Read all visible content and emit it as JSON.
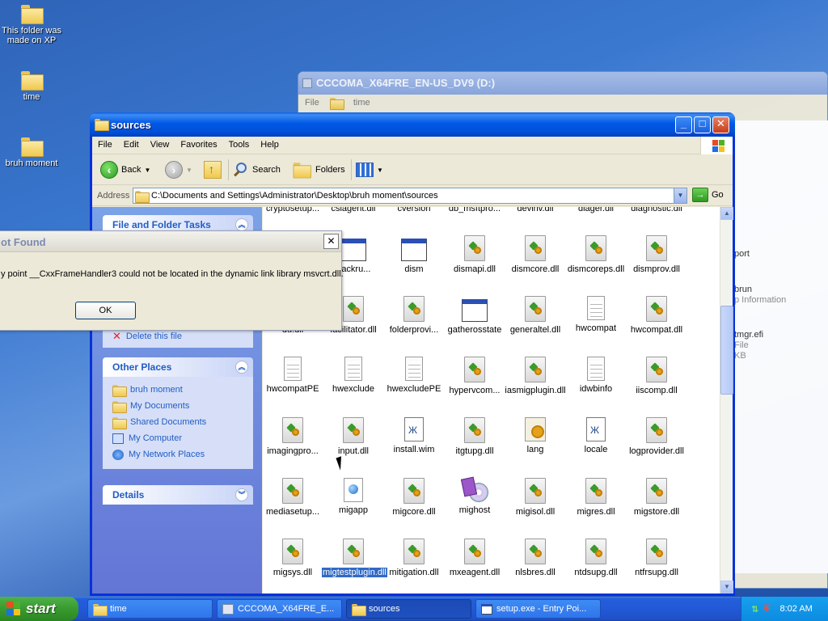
{
  "desktop": {
    "icons": [
      {
        "label": "This folder was made on XP"
      },
      {
        "label": "time"
      },
      {
        "label": "bruh moment"
      }
    ]
  },
  "back_window": {
    "title": "CCCOMA_X64FRE_EN-US_DV9 (D:)",
    "menu_file": "File",
    "tab": "time",
    "side_texts": [
      "port",
      "brun",
      "p Information",
      "tmgr.efi",
      "File",
      "KB"
    ]
  },
  "window": {
    "title": "sources",
    "menu": [
      "File",
      "Edit",
      "View",
      "Favorites",
      "Tools",
      "Help"
    ],
    "toolbar": {
      "back": "Back",
      "search": "Search",
      "folders": "Folders"
    },
    "address": {
      "label": "Address",
      "path": "C:\\Documents and Settings\\Administrator\\Desktop\\bruh moment\\sources",
      "go": "Go"
    },
    "tasks_panel": {
      "title": "File and Folder Tasks",
      "delete": "Delete this file"
    },
    "other_places": {
      "title": "Other Places",
      "items": [
        "bruh moment",
        "My Documents",
        "Shared Documents",
        "My Computer",
        "My Network Places"
      ]
    },
    "details": {
      "title": "Details"
    },
    "files": [
      {
        "name": "cryptosetup...",
        "icon": "dll"
      },
      {
        "name": "csiagent.dll",
        "icon": "dll"
      },
      {
        "name": "cversion",
        "icon": "dll"
      },
      {
        "name": "db_msftpro...",
        "icon": "dll"
      },
      {
        "name": "devinv.dll",
        "icon": "dll"
      },
      {
        "name": "diager.dll",
        "icon": "dll"
      },
      {
        "name": "diagnostic.dll",
        "icon": "dll"
      },
      {
        "name": "",
        "icon": "none"
      },
      {
        "name": "trackru...",
        "icon": "exe"
      },
      {
        "name": "dism",
        "icon": "exe"
      },
      {
        "name": "dismapi.dll",
        "icon": "dll"
      },
      {
        "name": "dismcore.dll",
        "icon": "dll"
      },
      {
        "name": "dismcoreps.dll",
        "icon": "dll"
      },
      {
        "name": "dismprov.dll",
        "icon": "dll"
      },
      {
        "name": "du.dll",
        "icon": "none"
      },
      {
        "name": "facilitator.dll",
        "icon": "dll"
      },
      {
        "name": "folderprovi...",
        "icon": "dll"
      },
      {
        "name": "gatherosstate",
        "icon": "exe"
      },
      {
        "name": "generaltel.dll",
        "icon": "dll"
      },
      {
        "name": "hwcompat",
        "icon": "txt"
      },
      {
        "name": "hwcompat.dll",
        "icon": "dll"
      },
      {
        "name": "hwcompatPE",
        "icon": "txt"
      },
      {
        "name": "hwexclude",
        "icon": "txt"
      },
      {
        "name": "hwexcludePE",
        "icon": "txt"
      },
      {
        "name": "hypervcom...",
        "icon": "dll"
      },
      {
        "name": "iasmigplugin.dll",
        "icon": "dll"
      },
      {
        "name": "idwbinfo",
        "icon": "txt"
      },
      {
        "name": "iiscomp.dll",
        "icon": "dll"
      },
      {
        "name": "imagingpro...",
        "icon": "dll"
      },
      {
        "name": "input.dll",
        "icon": "dll"
      },
      {
        "name": "install.wim",
        "icon": "wim"
      },
      {
        "name": "itgtupg.dll",
        "icon": "dll"
      },
      {
        "name": "lang",
        "icon": "lang"
      },
      {
        "name": "locale",
        "icon": "wim"
      },
      {
        "name": "logprovider.dll",
        "icon": "dll"
      },
      {
        "name": "mediasetup...",
        "icon": "dll"
      },
      {
        "name": "migapp",
        "icon": "globe"
      },
      {
        "name": "migcore.dll",
        "icon": "dll"
      },
      {
        "name": "mighost",
        "icon": "cd"
      },
      {
        "name": "migisol.dll",
        "icon": "dll"
      },
      {
        "name": "migres.dll",
        "icon": "dll"
      },
      {
        "name": "migstore.dll",
        "icon": "dll"
      },
      {
        "name": "migsys.dll",
        "icon": "dll"
      },
      {
        "name": "migtestplugin.dll",
        "icon": "dll",
        "selected": true
      },
      {
        "name": "mitigation.dll",
        "icon": "dll"
      },
      {
        "name": "mxeagent.dll",
        "icon": "dll"
      },
      {
        "name": "nlsbres.dll",
        "icon": "dll"
      },
      {
        "name": "ntdsupg.dll",
        "icon": "dll"
      },
      {
        "name": "ntfrsupg.dll",
        "icon": "dll"
      }
    ]
  },
  "dialog": {
    "title": "ot Found",
    "message": "y point __CxxFrameHandler3 could not be located in the dynamic link library msvcrt.dll.",
    "ok": "OK"
  },
  "taskbar": {
    "start": "start",
    "tasks": [
      "time",
      "CCCOMA_X64FRE_E...",
      "sources",
      "setup.exe - Entry Poi..."
    ],
    "clock": "8:02 AM"
  },
  "colors": {
    "title_blue": "#0058e6",
    "panel_link": "#215dc6",
    "start_green": "#389a2f",
    "selection": "#316ac5"
  }
}
